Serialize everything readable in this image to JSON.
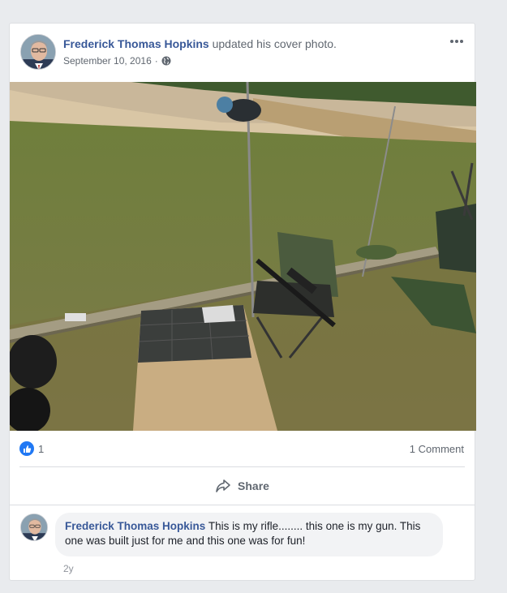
{
  "post": {
    "author": "Frederick Thomas Hopkins",
    "action": "updated his cover photo.",
    "date": "September 10, 2016",
    "date_separator": "·",
    "privacy_icon": "globe-icon",
    "more_icon": "more-options-icon"
  },
  "photo": {
    "description_icon": "cover-photo"
  },
  "reactions": {
    "like_count": "1",
    "comment_count": "1 Comment"
  },
  "actions": {
    "share_label": "Share"
  },
  "comment": {
    "author": "Frederick Thomas Hopkins",
    "text": " This is my rifle........ this one is my gun. This one was built just for me and this one was for fun!",
    "time": "2y"
  },
  "colors": {
    "link": "#385898",
    "like_blue": "#2078f4",
    "page_bg": "#e9ebee"
  }
}
